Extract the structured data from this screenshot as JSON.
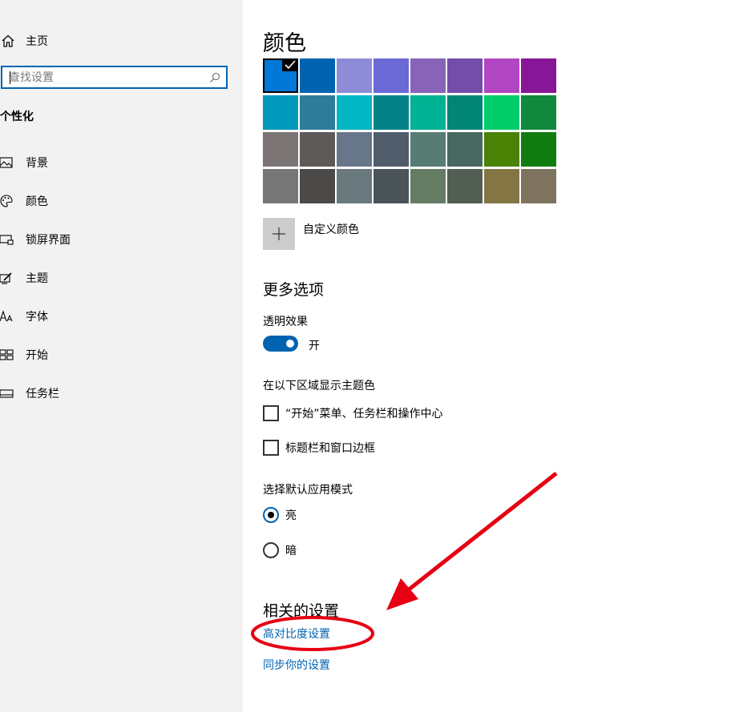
{
  "sidebar": {
    "home_label": "主页",
    "search": {
      "placeholder": "查找设置"
    },
    "section_title": "个性化",
    "items": [
      {
        "label": "背景",
        "icon": "picture-icon"
      },
      {
        "label": "颜色",
        "icon": "palette-icon"
      },
      {
        "label": "锁屏界面",
        "icon": "lock-screen-icon"
      },
      {
        "label": "主题",
        "icon": "theme-brush-icon"
      },
      {
        "label": "字体",
        "icon": "font-icon"
      },
      {
        "label": "开始",
        "icon": "start-grid-icon"
      },
      {
        "label": "任务栏",
        "icon": "taskbar-icon"
      }
    ]
  },
  "main": {
    "title": "颜色",
    "swatches": [
      "#0078d7",
      "#0063b1",
      "#8e8cd8",
      "#6b69d6",
      "#8764b8",
      "#744da9",
      "#b146c2",
      "#881798",
      "#0099bc",
      "#2d7d9a",
      "#00b7c3",
      "#038387",
      "#00b294",
      "#018574",
      "#00cc6a",
      "#10893e",
      "#7a7574",
      "#5d5a58",
      "#68768a",
      "#515c6b",
      "#567c73",
      "#486860",
      "#498205",
      "#107c10",
      "#767676",
      "#4c4a48",
      "#69797e",
      "#4a5459",
      "#647c64",
      "#525e54",
      "#847545",
      "#7e735f"
    ],
    "selected_swatch": 0,
    "custom_color_label": "自定义颜色",
    "more_options_heading": "更多选项",
    "transparency_label": "透明效果",
    "transparency_state": "开",
    "accent_surfaces_label": "在以下区域显示主题色",
    "checkbox_start_label": "“开始”菜单、任务栏和操作中心",
    "checkbox_titlebar_label": "标题栏和窗口边框",
    "app_mode_label": "选择默认应用模式",
    "mode_light": "亮",
    "mode_dark": "暗",
    "related_heading": "相关的设置",
    "link_contrast": "高对比度设置",
    "link_sync": "同步你的设置"
  },
  "colors": {
    "accent": "#0063b1",
    "sidebar_bg": "#f2f2f2",
    "annotation": "#e60012"
  }
}
